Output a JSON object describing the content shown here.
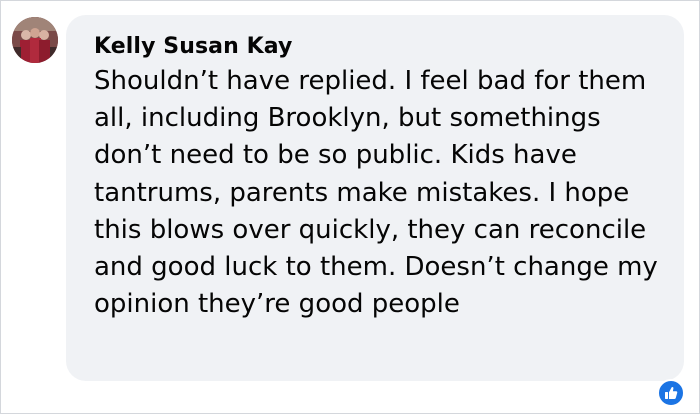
{
  "comment": {
    "author_name": "Kelly Susan Kay",
    "text": "Shouldn’t have replied. I feel bad for them all, including Brooklyn, but somethings don’t need to be so public. Kids have tantrums, parents make mistakes. I hope this blows over quickly, they can reconcile and good luck to them. Doesn’t change my opinion they’re good people",
    "avatar_icon": "profile-photo",
    "reaction_icon": "like-thumbs-up-icon",
    "colors": {
      "bubble_bg": "#f0f2f5",
      "text": "#050505",
      "reaction_blue": "#1b74e4"
    }
  }
}
